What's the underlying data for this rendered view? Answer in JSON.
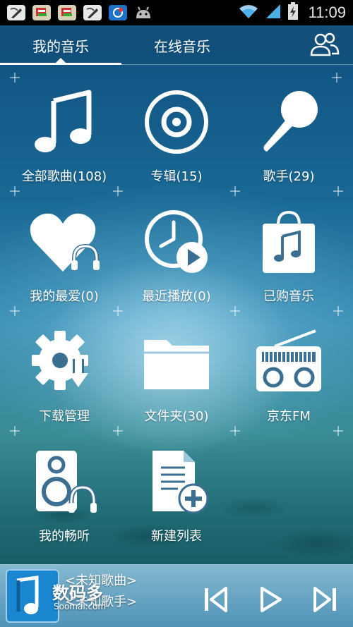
{
  "status_bar": {
    "time": "11:09",
    "icons": [
      "note-icon",
      "note-icon",
      "note-icon",
      "note-icon",
      "app-icon",
      "android-icon",
      "wifi-icon",
      "signal-icon",
      "battery-charging-icon"
    ]
  },
  "tabs": [
    {
      "label": "我的音乐",
      "selected": true
    },
    {
      "label": "在线音乐",
      "selected": false
    }
  ],
  "friends_icon": "friends-icon",
  "grid": [
    {
      "label": "全部歌曲(108)",
      "icon": "music-note-icon"
    },
    {
      "label": "专辑(15)",
      "icon": "disc-icon"
    },
    {
      "label": "歌手(29)",
      "icon": "microphone-icon"
    },
    {
      "label": "我的最爱(0)",
      "icon": "heart-headphones-icon"
    },
    {
      "label": "最近播放(0)",
      "icon": "clock-play-icon"
    },
    {
      "label": "已购音乐",
      "icon": "shopping-bag-music-icon"
    },
    {
      "label": "下载管理",
      "icon": "gear-download-icon"
    },
    {
      "label": "文件夹(30)",
      "icon": "folder-icon"
    },
    {
      "label": "京东FM",
      "icon": "radio-icon"
    },
    {
      "label": "我的畅听",
      "icon": "speaker-headphones-icon"
    },
    {
      "label": "新建列表",
      "icon": "new-list-icon"
    }
  ],
  "player": {
    "song_title": "<未知歌曲>",
    "artist": "<未知歌手>",
    "watermark_big": "数码多",
    "watermark_small": "Soomal.com",
    "controls": [
      "previous-icon",
      "play-icon",
      "next-icon"
    ]
  },
  "colors": {
    "accent": "#ffffff",
    "background_top": "#0f4f7e",
    "background_bottom": "#114a55"
  }
}
